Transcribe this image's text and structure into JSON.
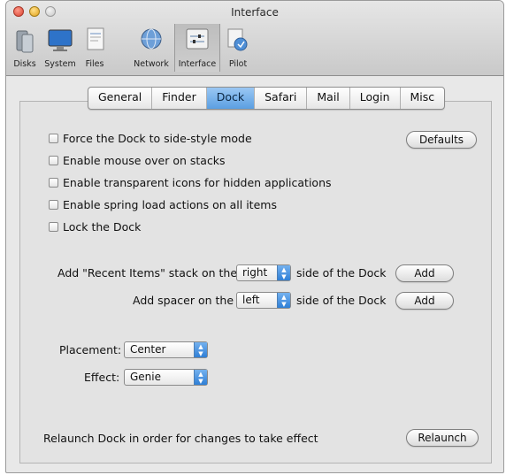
{
  "window": {
    "title": "Interface"
  },
  "toolbar": {
    "items": [
      {
        "label": "Disks",
        "icon": "disks-icon"
      },
      {
        "label": "System",
        "icon": "system-icon"
      },
      {
        "label": "Files",
        "icon": "files-icon"
      },
      {
        "label": "Network",
        "icon": "network-icon"
      },
      {
        "label": "Interface",
        "icon": "interface-icon"
      },
      {
        "label": "Pilot",
        "icon": "pilot-icon"
      }
    ],
    "selected": "Interface"
  },
  "tabs": [
    "General",
    "Finder",
    "Dock",
    "Safari",
    "Mail",
    "Login",
    "Misc"
  ],
  "active_tab": "Dock",
  "options": {
    "force_side_style": "Force the Dock to side-style mode",
    "mouse_over_stacks": "Enable mouse over on stacks",
    "transparent_icons": "Enable transparent icons for hidden applications",
    "spring_load": "Enable spring load actions on all items",
    "lock_dock": "Lock the Dock"
  },
  "defaults_button": "Defaults",
  "recent_items": {
    "prefix": "Add \"Recent Items\" stack on the",
    "side": "right",
    "suffix": "side of the Dock",
    "button": "Add"
  },
  "spacer": {
    "prefix": "Add spacer on the",
    "side": "left",
    "suffix": "side of the Dock",
    "button": "Add"
  },
  "placement": {
    "label": "Placement:",
    "value": "Center"
  },
  "effect": {
    "label": "Effect:",
    "value": "Genie"
  },
  "relaunch": {
    "message": "Relaunch Dock in order for changes to take effect",
    "button": "Relaunch"
  },
  "colors": {
    "accent": "#5b9fe2",
    "window_bg": "#e8e8e8"
  }
}
